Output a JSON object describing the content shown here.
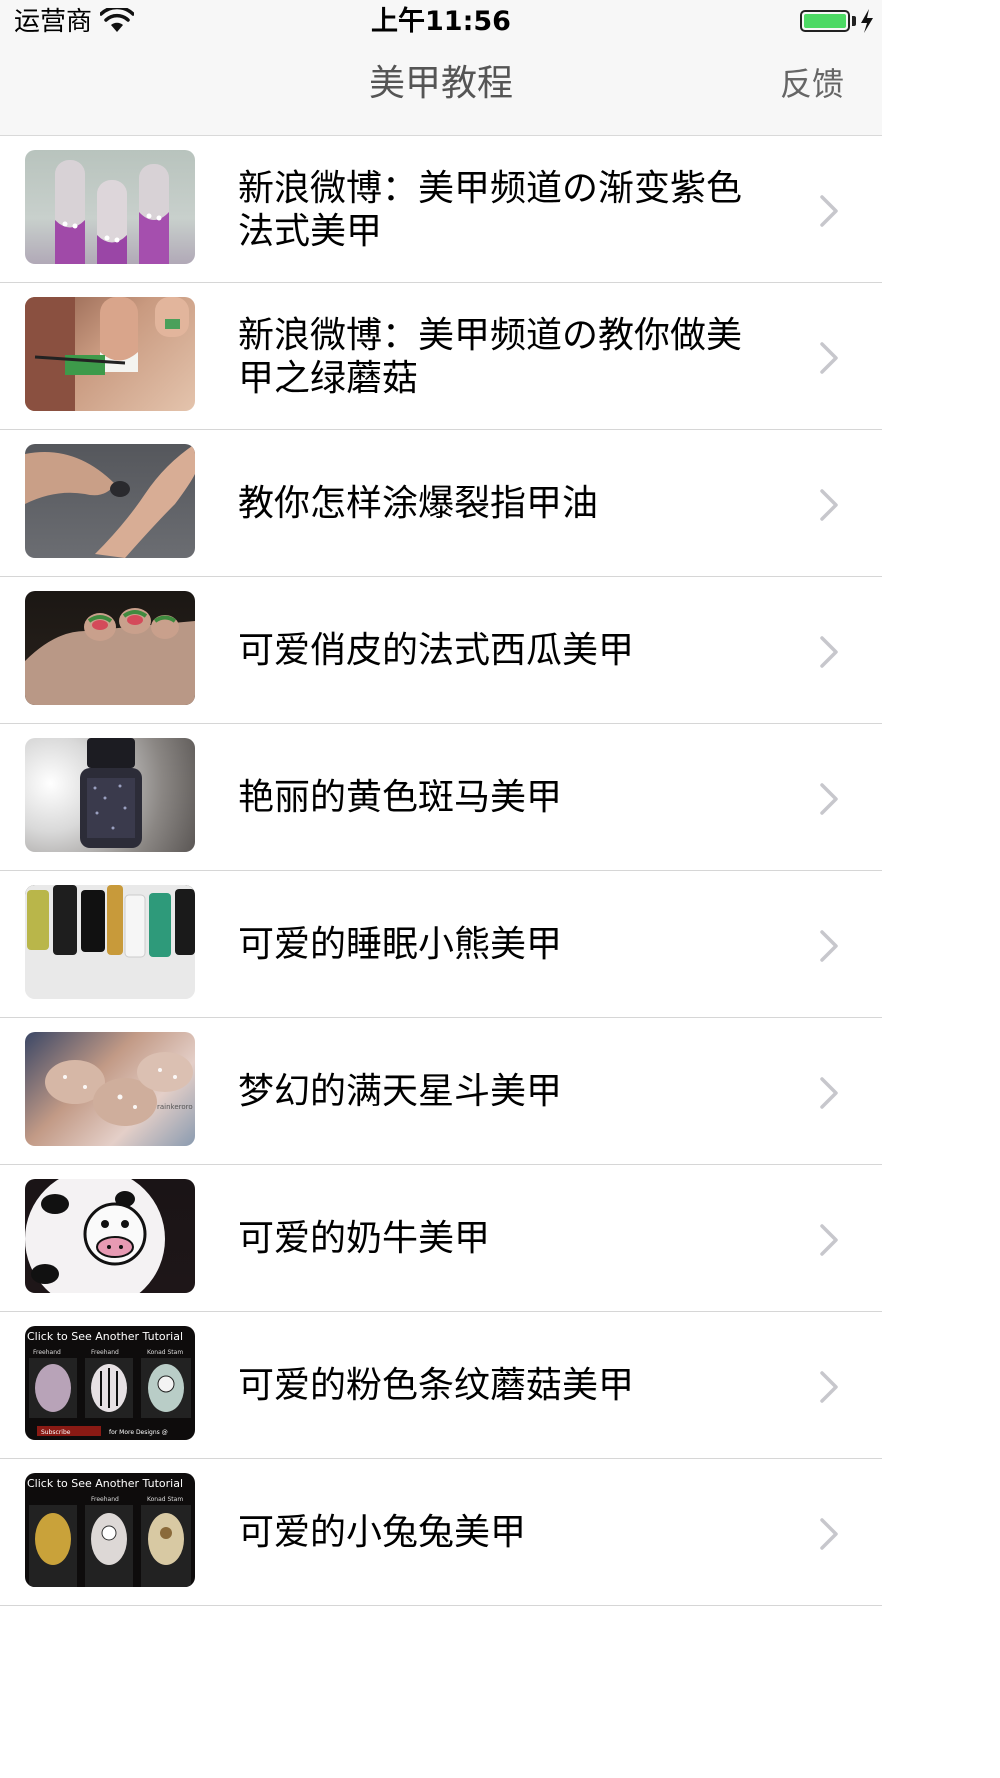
{
  "status_bar": {
    "carrier": "运营商",
    "time": "上午11:56",
    "battery_color": "#4cd964"
  },
  "nav": {
    "title": "美甲教程",
    "feedback": "反馈"
  },
  "list": {
    "items": [
      {
        "line1": "新浪微博：美甲频道の渐变紫色",
        "line2": "法式美甲"
      },
      {
        "line1": "新浪微博：美甲频道の教你做美",
        "line2": "甲之绿蘑菇"
      },
      {
        "line1": "教你怎样涂爆裂指甲油",
        "line2": ""
      },
      {
        "line1": "可爱俏皮的法式西瓜美甲",
        "line2": ""
      },
      {
        "line1": "艳丽的黄色斑马美甲",
        "line2": ""
      },
      {
        "line1": "可爱的睡眠小熊美甲",
        "line2": ""
      },
      {
        "line1": "梦幻的满天星斗美甲",
        "line2": ""
      },
      {
        "line1": "可爱的奶牛美甲",
        "line2": ""
      },
      {
        "line1": "可爱的粉色条纹蘑菇美甲",
        "line2": ""
      },
      {
        "line1": "可爱的小兔兔美甲",
        "line2": ""
      }
    ],
    "thumb_texts": {
      "tutorial_banner": "Click to See Another Tutorial",
      "freehand": "Freehand",
      "konad": "Konad Stam",
      "subscribe": "Subscribe",
      "more_designs": "for More Designs @",
      "watermark": "rainkeroro"
    }
  }
}
